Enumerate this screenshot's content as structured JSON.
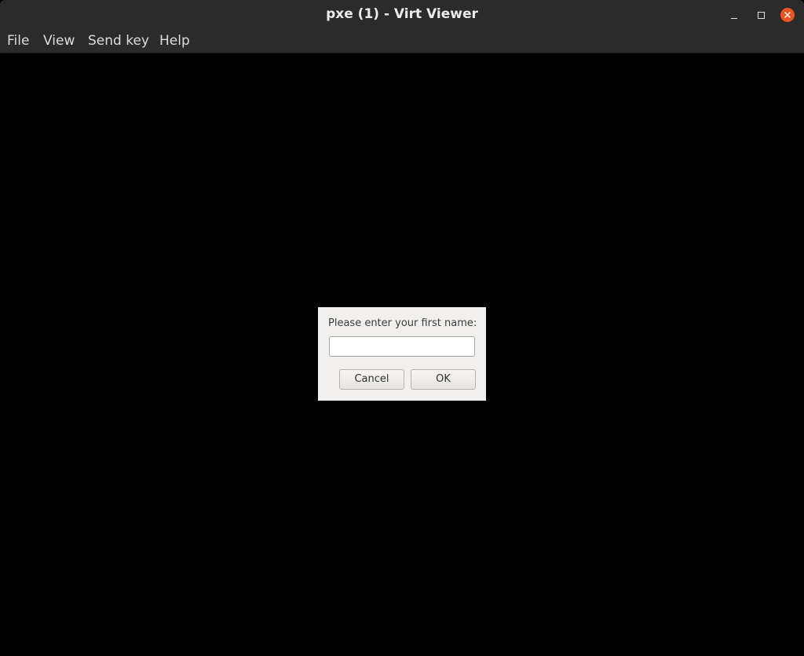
{
  "window": {
    "title": "pxe (1) - Virt Viewer",
    "controls": [
      "minimize-icon",
      "maximize-icon",
      "close-icon"
    ],
    "close_color": "#e95420"
  },
  "menubar": {
    "items": [
      {
        "label": "File"
      },
      {
        "label": "View"
      },
      {
        "label": "Send key"
      },
      {
        "label": "Help"
      }
    ]
  },
  "dialog": {
    "prompt": "Please enter your first name:",
    "input_value": "",
    "cancel_label": "Cancel",
    "ok_label": "OK"
  },
  "colors": {
    "titlebar_bg": "#2b2b2b",
    "display_bg": "#000000",
    "dialog_bg": "#f1f0ee"
  }
}
